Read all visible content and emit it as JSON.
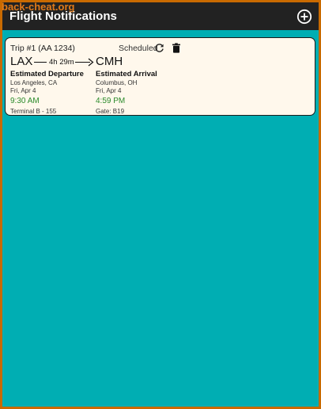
{
  "watermark": "back-cheat.org",
  "app": {
    "title": "Flight Notifications",
    "add_icon": "add-circle-icon"
  },
  "trip": {
    "label": "Trip #1 (AA 1234)",
    "status": "Scheduled",
    "refresh_icon": "refresh-icon",
    "delete_icon": "trash-icon",
    "duration": "4h 29m",
    "departure": {
      "code": "LAX",
      "heading": "Estimated Departure",
      "city": "Los Angeles, CA",
      "date": "Fri, Apr 4",
      "time": "9:30 AM",
      "gate": "Terminal B - 155"
    },
    "arrival": {
      "code": "CMH",
      "heading": "Estimated Arrival",
      "city": "Columbus, OH",
      "date": "Fri, Apr 4",
      "time": "4:59 PM",
      "gate": "Gate: B19"
    }
  },
  "colors": {
    "background": "#00aeb3",
    "appbar": "#222222",
    "card": "#fff8ec",
    "time_green": "#2a8a2a",
    "frame_border": "#c96a00"
  }
}
